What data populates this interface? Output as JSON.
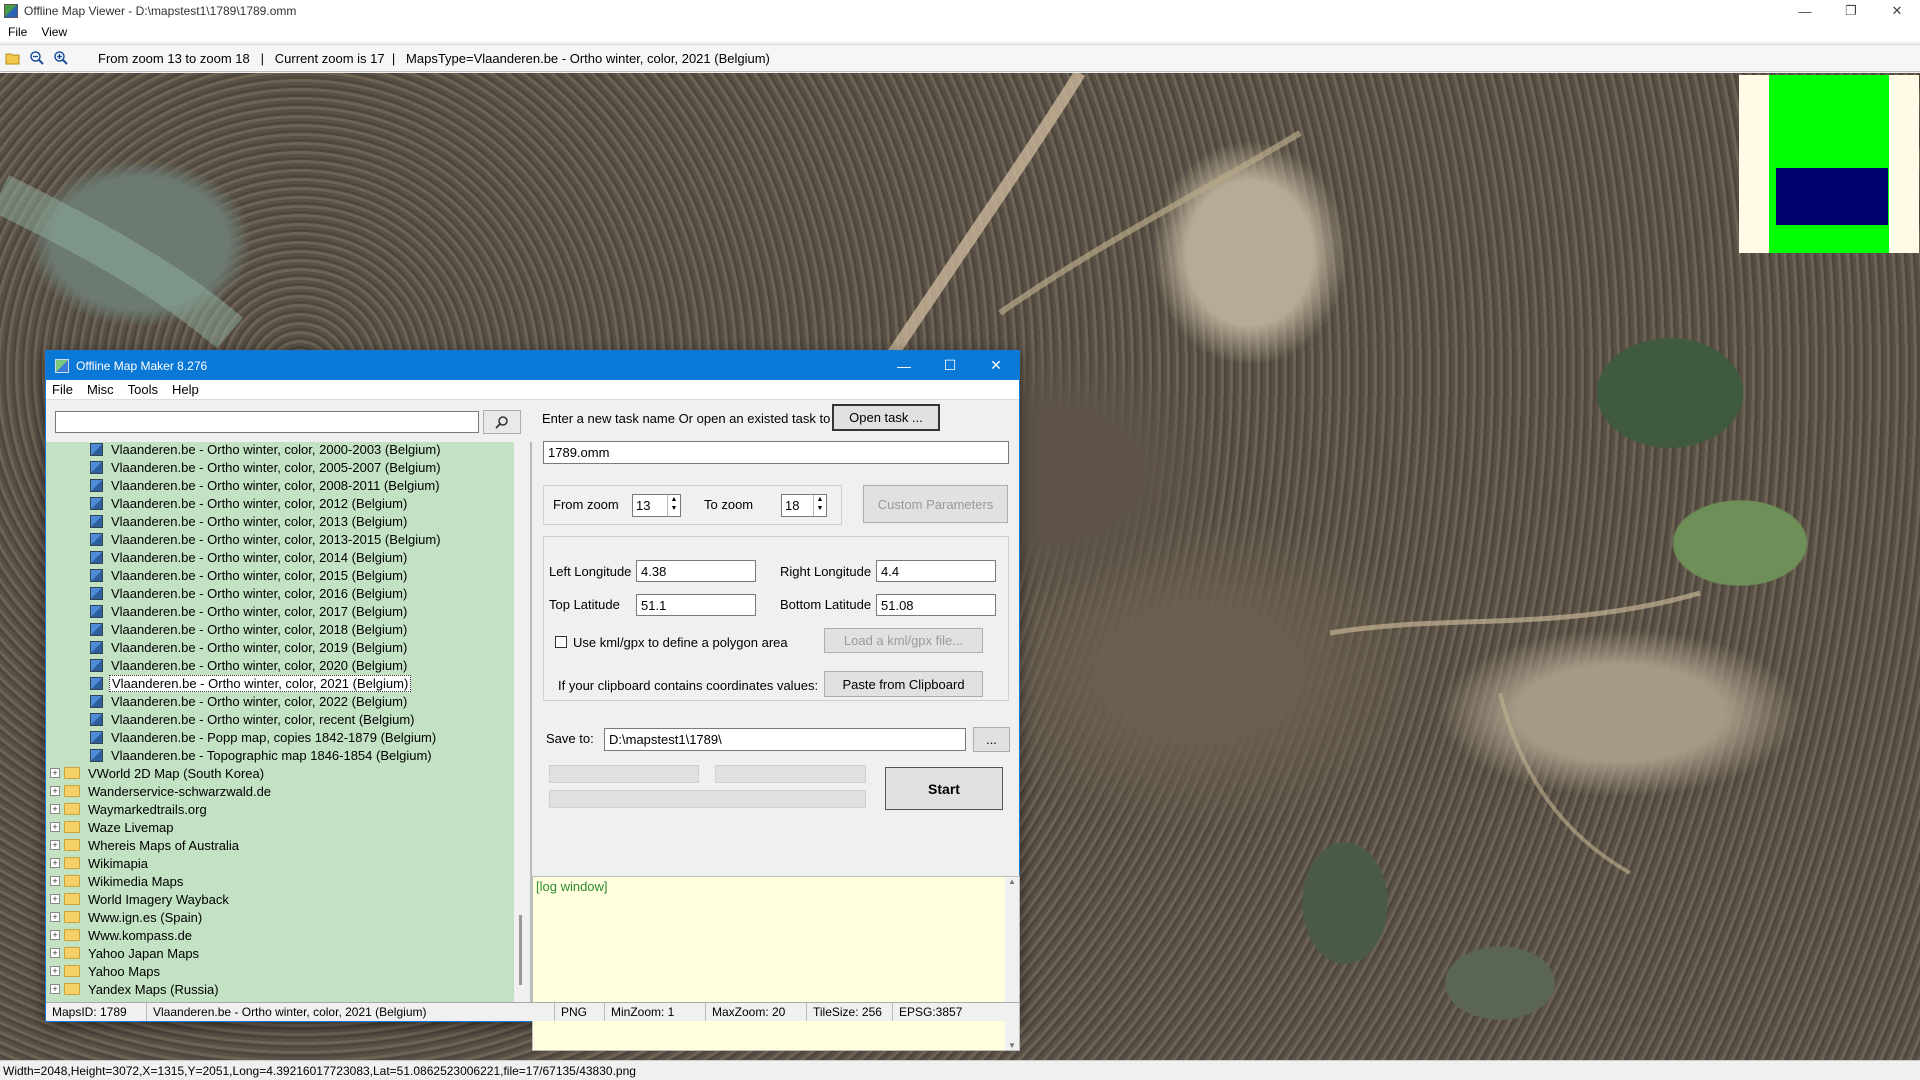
{
  "window": {
    "title": "Offline Map Viewer - D:\\mapstest1\\1789\\1789.omm",
    "minimize": "—",
    "maximize": "❐",
    "close": "✕"
  },
  "menu": {
    "file": "File",
    "view": "View"
  },
  "toolbar": {
    "info": "From zoom 13 to zoom 18   |   Current zoom is 17  |   MapsType=Vlaanderen.be - Ortho winter, color, 2021 (Belgium)"
  },
  "statusbar": {
    "text": "Width=2048,Height=3072,X=1315,Y=2051,Long=4.39216017723083,Lat=51.0862523006221,file=17/67135/43830.png"
  },
  "dialog": {
    "title": "Offline Map Maker 8.276",
    "menu": [
      "File",
      "Misc",
      "Tools",
      "Help"
    ],
    "search": {
      "value": "",
      "placeholder": ""
    },
    "tree": {
      "children": [
        "Vlaanderen.be - Ortho winter, color, 2000-2003 (Belgium)",
        "Vlaanderen.be - Ortho winter, color, 2005-2007 (Belgium)",
        "Vlaanderen.be - Ortho winter, color, 2008-2011 (Belgium)",
        "Vlaanderen.be - Ortho winter, color, 2012 (Belgium)",
        "Vlaanderen.be - Ortho winter, color, 2013 (Belgium)",
        "Vlaanderen.be - Ortho winter, color, 2013-2015 (Belgium)",
        "Vlaanderen.be - Ortho winter, color, 2014 (Belgium)",
        "Vlaanderen.be - Ortho winter, color, 2015 (Belgium)",
        "Vlaanderen.be - Ortho winter, color, 2016 (Belgium)",
        "Vlaanderen.be - Ortho winter, color, 2017 (Belgium)",
        "Vlaanderen.be - Ortho winter, color, 2018 (Belgium)",
        "Vlaanderen.be - Ortho winter, color, 2019 (Belgium)",
        "Vlaanderen.be - Ortho winter, color, 2020 (Belgium)",
        "Vlaanderen.be - Ortho winter, color, 2021 (Belgium)",
        "Vlaanderen.be - Ortho winter, color, 2022 (Belgium)",
        "Vlaanderen.be - Ortho winter, color, recent (Belgium)",
        "Vlaanderen.be - Popp map, copies 1842-1879 (Belgium)",
        "Vlaanderen.be - Topographic map 1846-1854 (Belgium)"
      ],
      "selected": "Vlaanderen.be - Ortho winter, color, 2021 (Belgium)",
      "folders": [
        "VWorld 2D Map (South Korea)",
        "Wanderservice-schwarzwald.de",
        "Waymarkedtrails.org",
        "Waze Livemap",
        "Whereis Maps of Australia",
        "Wikimapia",
        "Wikimedia Maps",
        "World Imagery Wayback",
        "Www.ign.es (Spain)",
        "Www.kompass.de",
        "Yahoo Japan Maps",
        "Yahoo Maps",
        "Yandex Maps (Russia)"
      ]
    },
    "task": {
      "prompt": "Enter a new task name Or open an existed task to continue:",
      "open_button": "Open task ...",
      "name": "1789.omm"
    },
    "zoom": {
      "from_label": "From zoom",
      "from_value": "13",
      "to_label": "To zoom",
      "to_value": "18",
      "custom_button": "Custom Parameters"
    },
    "coords": {
      "left_lon_label": "Left Longitude",
      "left_lon": "4.38",
      "right_lon_label": "Right Longitude",
      "right_lon": "4.4",
      "top_lat_label": "Top Latitude",
      "top_lat": "51.1",
      "bottom_lat_label": "Bottom Latitude",
      "bottom_lat": "51.08"
    },
    "kml": {
      "label": "Use kml/gpx to define a polygon area",
      "checked": false,
      "button": "Load a kml/gpx file..."
    },
    "clipboard": {
      "label": "If your clipboard contains coordinates values:",
      "button": "Paste from Clipboard"
    },
    "save": {
      "label": "Save to:",
      "path": "D:\\mapstest1\\1789\\",
      "browse": "..."
    },
    "start_button": "Start",
    "log": "[log window]",
    "status": {
      "maps_id": "MapsID: 1789",
      "map_name": "Vlaanderen.be - Ortho winter, color, 2021 (Belgium)",
      "format": "PNG",
      "min_zoom": "MinZoom: 1",
      "max_zoom": "MaxZoom: 20",
      "tile_size": "TileSize: 256",
      "epsg": "EPSG:3857"
    }
  },
  "colors": {
    "tree_bg": "#c3e2c3",
    "title_blue": "#0a78d7",
    "minimap_green": "#00ff00",
    "minimap_blue": "#00006e",
    "log_bg": "#ffffe0"
  }
}
